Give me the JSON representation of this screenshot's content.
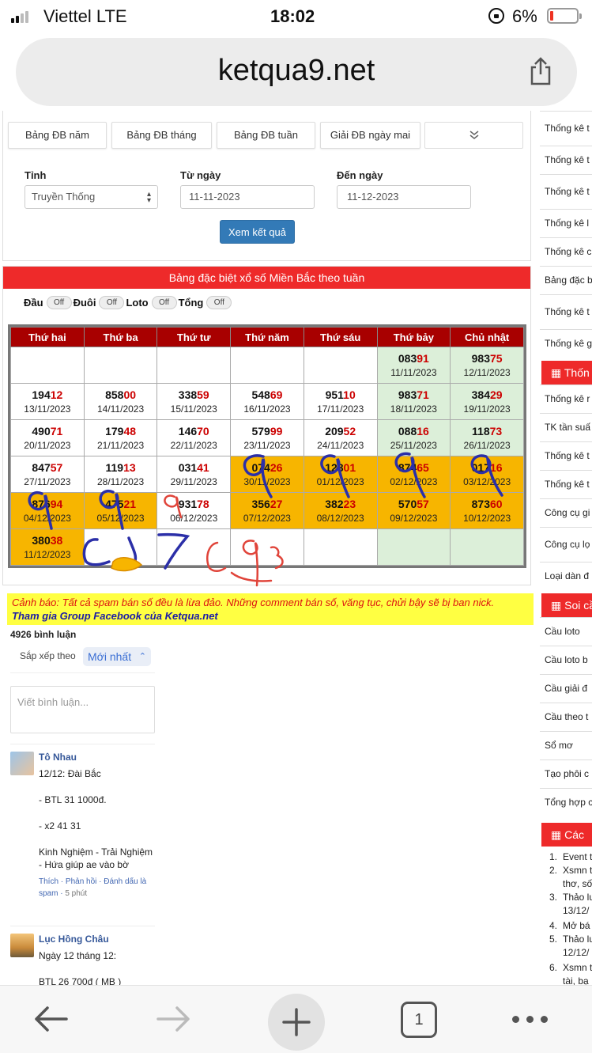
{
  "status": {
    "carrier": "Viettel  LTE",
    "time": "18:02",
    "battery": "6%"
  },
  "browser": {
    "url": "ketqua9.net",
    "tab_count": "1"
  },
  "filters": {
    "tabs": [
      "Bảng ĐB năm",
      "Bảng ĐB tháng",
      "Bảng ĐB tuần",
      "Giải ĐB ngày mai"
    ],
    "province_label": "Tỉnh",
    "province_value": "Truyền Thống",
    "from_label": "Từ ngày",
    "from_value": "11-11-2023",
    "to_label": "Đến ngày",
    "to_value": "11-12-2023",
    "submit": "Xem kết quả"
  },
  "results": {
    "title": "Bảng đặc biệt xổ số Miền Bắc theo tuần",
    "toggles": [
      {
        "label": "Đầu",
        "state": "Off"
      },
      {
        "label": "Đuôi",
        "state": "Off"
      },
      {
        "label": "Loto",
        "state": "Off"
      },
      {
        "label": "Tổng",
        "state": "Off"
      }
    ],
    "headers": [
      "Thứ hai",
      "Thứ ba",
      "Thứ tư",
      "Thứ năm",
      "Thứ sáu",
      "Thứ bảy",
      "Chủ nhật"
    ],
    "rows": [
      [
        null,
        null,
        null,
        null,
        null,
        {
          "head": "083",
          "tail": "91",
          "date": "11/11/2023"
        },
        {
          "head": "983",
          "tail": "75",
          "date": "12/11/2023"
        }
      ],
      [
        {
          "head": "194",
          "tail": "12",
          "date": "13/11/2023"
        },
        {
          "head": "858",
          "tail": "00",
          "date": "14/11/2023"
        },
        {
          "head": "338",
          "tail": "59",
          "date": "15/11/2023"
        },
        {
          "head": "548",
          "tail": "69",
          "date": "16/11/2023"
        },
        {
          "head": "951",
          "tail": "10",
          "date": "17/11/2023"
        },
        {
          "head": "983",
          "tail": "71",
          "date": "18/11/2023"
        },
        {
          "head": "384",
          "tail": "29",
          "date": "19/11/2023"
        }
      ],
      [
        {
          "head": "490",
          "tail": "71",
          "date": "20/11/2023"
        },
        {
          "head": "179",
          "tail": "48",
          "date": "21/11/2023"
        },
        {
          "head": "146",
          "tail": "70",
          "date": "22/11/2023"
        },
        {
          "head": "579",
          "tail": "99",
          "date": "23/11/2023"
        },
        {
          "head": "209",
          "tail": "52",
          "date": "24/11/2023"
        },
        {
          "head": "088",
          "tail": "16",
          "date": "25/11/2023"
        },
        {
          "head": "118",
          "tail": "73",
          "date": "26/11/2023"
        }
      ],
      [
        {
          "head": "847",
          "tail": "57",
          "date": "27/11/2023"
        },
        {
          "head": "119",
          "tail": "13",
          "date": "28/11/2023"
        },
        {
          "head": "031",
          "tail": "41",
          "date": "29/11/2023"
        },
        {
          "head": "074",
          "tail": "26",
          "date": "30/11/2023",
          "hl": true
        },
        {
          "head": "128",
          "tail": "01",
          "date": "01/12/2023",
          "hl": true
        },
        {
          "head": "874",
          "tail": "65",
          "date": "02/12/2023",
          "hl": true
        },
        {
          "head": "017",
          "tail": "16",
          "date": "03/12/2023",
          "hl": true
        }
      ],
      [
        {
          "head": "876",
          "tail": "94",
          "date": "04/12/2023",
          "hl": true
        },
        {
          "head": "475",
          "tail": "21",
          "date": "05/12/2023",
          "hl": true
        },
        {
          "head": "931",
          "tail": "78",
          "date": "06/12/2023"
        },
        {
          "head": "356",
          "tail": "27",
          "date": "07/12/2023",
          "hl": true
        },
        {
          "head": "382",
          "tail": "23",
          "date": "08/12/2023",
          "hl": true
        },
        {
          "head": "570",
          "tail": "57",
          "date": "09/12/2023",
          "hl": true
        },
        {
          "head": "873",
          "tail": "60",
          "date": "10/12/2023",
          "hl": true
        }
      ],
      [
        {
          "head": "380",
          "tail": "38",
          "date": "11/12/2023",
          "hl": true
        },
        null,
        null,
        null,
        null,
        null,
        null
      ]
    ]
  },
  "comments": {
    "warning": "Cảnh báo: Tất cả spam bán số đều là lừa đảo. Những comment bán số, văng tục, chửi bậy sẽ bị ban nick.",
    "group_link": "Tham gia Group Facebook của Ketqua.net",
    "count": "4926 bình luận",
    "sort_label": "Sắp xếp theo",
    "sort_value": "Mới nhất",
    "input_placeholder": "Viết bình luận...",
    "items": [
      {
        "name": "Tô Nhau",
        "lines": [
          "12/12: Đài Bắc",
          "- BTL 31 1000đ.",
          "- x2 41 31",
          "Kinh Nghiệm - Trải Nghiệm - Hứa giúp ae vào bờ"
        ],
        "actions": "Thích · Phản hồi · Đánh dấu là spam",
        "time": "5 phút"
      },
      {
        "name": "Lục Hồng Châu",
        "lines": [
          "Ngày 12 tháng 12:",
          "BTL 26 700đ  ( MB )"
        ]
      }
    ]
  },
  "sidebar": {
    "items_top": [
      "Thống kê t loto",
      "Thống kê t",
      "Thống kê t loto",
      "Thống kê l",
      "Thống kê c",
      "Bảng đặc b",
      "Thống kê t theo Đặc B",
      "Thống kê g"
    ],
    "section1": "Thốn",
    "items_mid": [
      "Thống kê r",
      "TK tần suấ",
      "Thống kê t",
      "Thống kê t",
      "Công cụ gi",
      "Công cụ lọ VIP",
      "Loại dàn đ"
    ],
    "section2": "Soi cầ",
    "items_soi": [
      "Cầu loto",
      "Cầu loto b",
      "Cầu giải đ",
      "Cầu theo t",
      "Sổ mơ",
      "Tạo phôi c",
      "Tổng hợp c"
    ],
    "section3": "Các",
    "list": [
      {
        "n": "1.",
        "t": "Event t"
      },
      {
        "n": "2.",
        "t": "Xsmn t"
      },
      {
        "n": "",
        "t": "thơ, số"
      },
      {
        "n": "3.",
        "t": "Thảo lu"
      },
      {
        "n": "",
        "t": "13/12/"
      },
      {
        "n": "4.",
        "t": "Mở bá"
      },
      {
        "n": "5.",
        "t": "Thảo lu"
      },
      {
        "n": "",
        "t": "12/12/"
      },
      {
        "n": "6.",
        "t": "Xsmn t"
      },
      {
        "n": "",
        "t": "tài, bạ"
      }
    ]
  },
  "colors": {
    "accent_red": "#ee2a2a",
    "header_dark_red": "#a80000",
    "highlight": "#f7b500",
    "weekend": "#dcefd9",
    "button_blue": "#337ab7"
  }
}
